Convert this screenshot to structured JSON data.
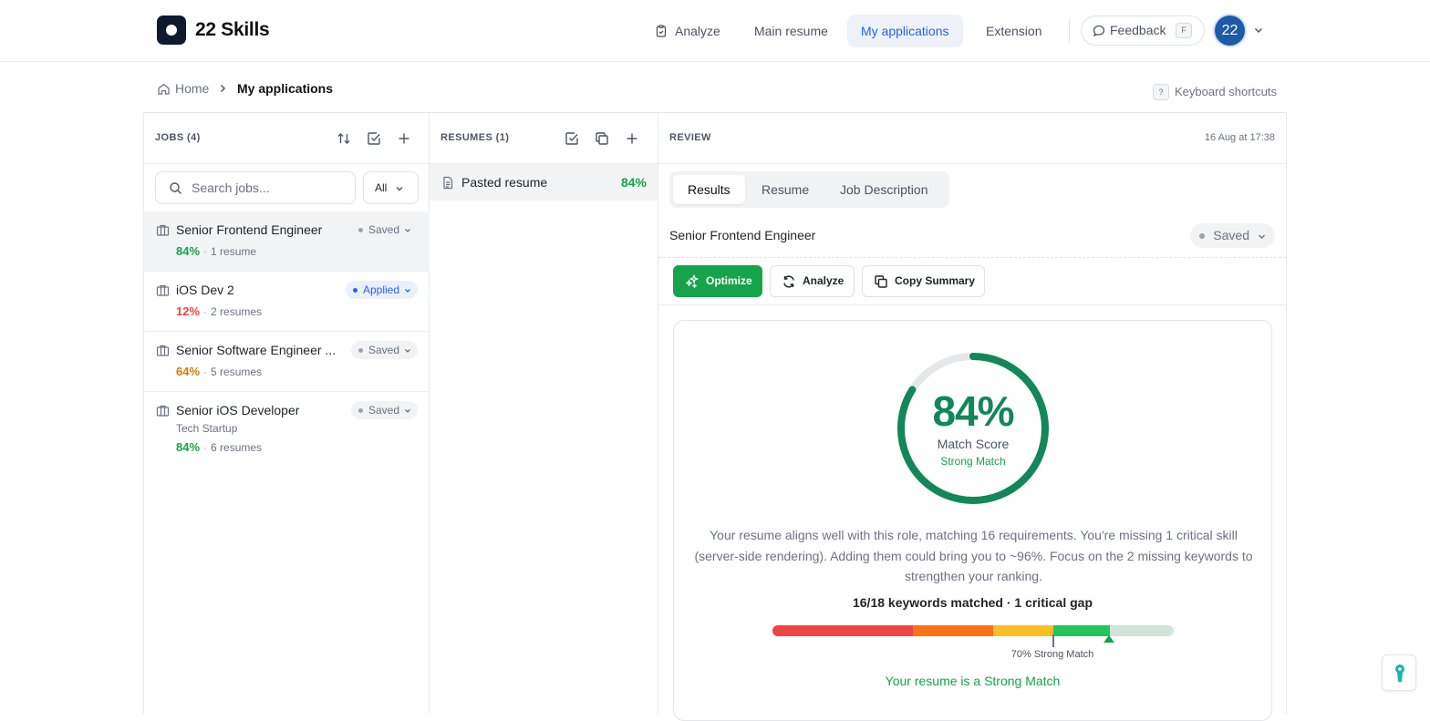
{
  "app": {
    "brand": "22 Skills"
  },
  "nav": {
    "items": [
      {
        "label": "Analyze",
        "icon": "clipboard-icon"
      },
      {
        "label": "Main resume"
      },
      {
        "label": "My applications",
        "active": true
      },
      {
        "label": "Extension"
      }
    ],
    "feedback_label": "Feedback",
    "feedback_key": "F",
    "avatar_text": "22"
  },
  "breadcrumb": {
    "home": "Home",
    "current": "My applications"
  },
  "shortcuts": {
    "key": "?",
    "label": "Keyboard shortcuts"
  },
  "jobs_panel": {
    "title": "JOBS (4)",
    "search_placeholder": "Search jobs...",
    "filter": "All",
    "jobs": [
      {
        "title": "Senior Frontend Engineer",
        "status": "Saved",
        "pct": "84%",
        "resumes": "1 resume",
        "company": ""
      },
      {
        "title": "iOS Dev 2",
        "status": "Applied",
        "pct": "12%",
        "resumes": "2 resumes",
        "company": ""
      },
      {
        "title": "Senior Software Engineer ...",
        "status": "Saved",
        "pct": "64%",
        "resumes": "5 resumes",
        "company": ""
      },
      {
        "title": "Senior iOS Developer",
        "status": "Saved",
        "pct": "84%",
        "resumes": "6 resumes",
        "company": "Tech Startup"
      }
    ]
  },
  "resumes_panel": {
    "title": "RESUMES (1)",
    "resumes": [
      {
        "name": "Pasted resume",
        "pct": "84%"
      }
    ]
  },
  "review": {
    "title": "REVIEW",
    "date": "16 Aug at 17:38",
    "tabs": [
      "Results",
      "Resume",
      "Job Description"
    ],
    "job_title": "Senior Frontend Engineer",
    "status": "Saved",
    "buttons": {
      "optimize": "Optimize",
      "analyze": "Analyze",
      "copy": "Copy Summary"
    },
    "score": {
      "value": "84%",
      "fraction": 0.84,
      "label": "Match Score",
      "rating": "Strong Match"
    },
    "summary": "Your resume aligns well with this role, matching 16 requirements. You're missing 1 critical skill (server-side rendering). Adding them could bring you to ~96%. Focus on the 2 missing keywords to strengthen your ranking.",
    "keywords_line": "16/18 keywords matched · 1 critical gap",
    "threshold_label": "70% Strong Match",
    "verdict": "Your resume is a Strong Match"
  },
  "colors": {
    "accent": "#16a34a",
    "score_ring": "#11875a",
    "link_active": "#2563eb",
    "danger": "#ef4444",
    "warning": "#d97706"
  }
}
